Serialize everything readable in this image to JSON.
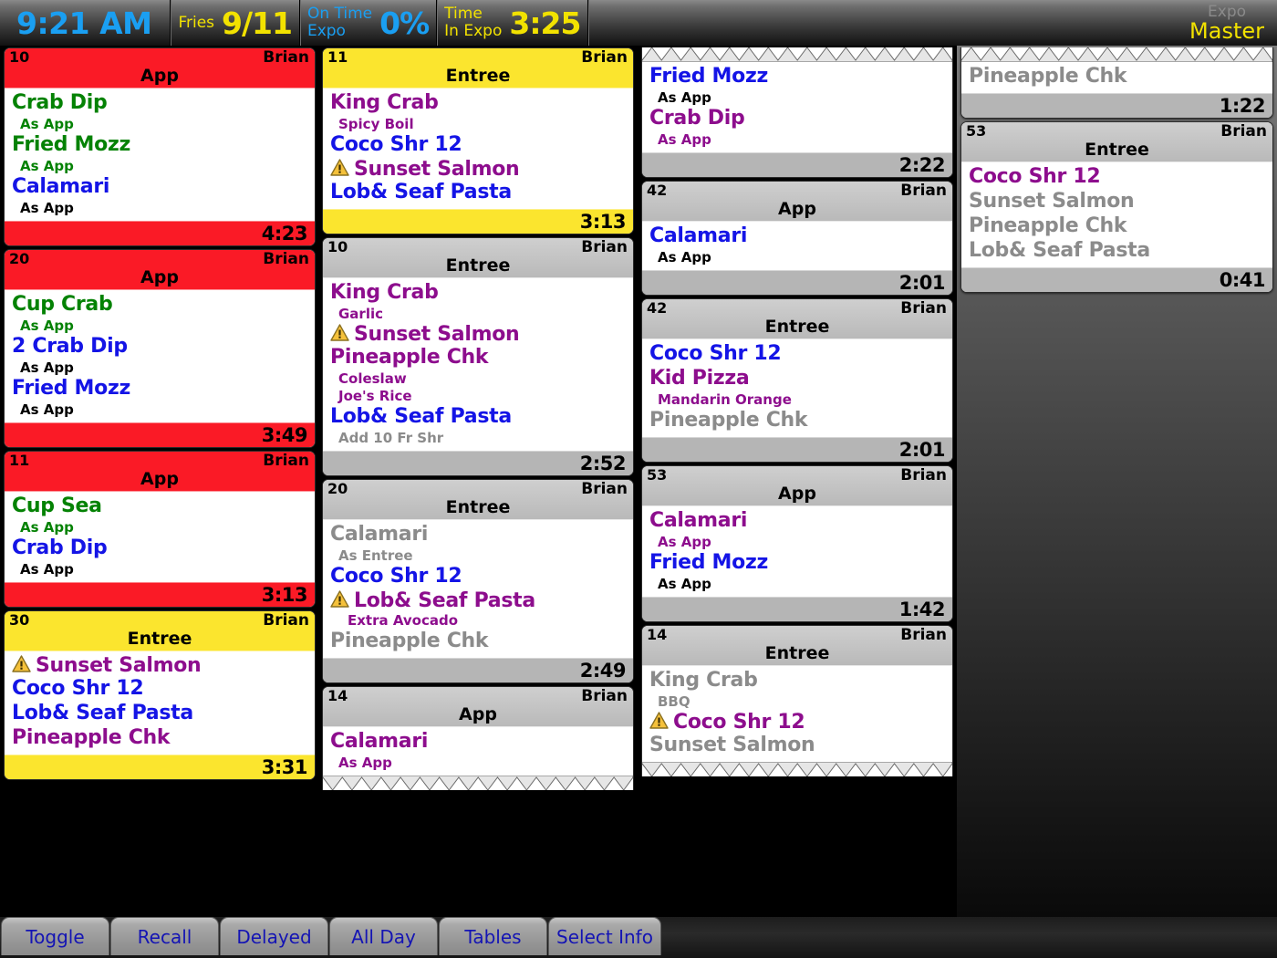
{
  "header": {
    "clock": "9:21 AM",
    "fries_label": "Fries",
    "fries_value": "9/11",
    "ontime_label_1": "On Time",
    "ontime_label_2": "Expo",
    "ontime_value": "0%",
    "timein_label_1": "Time",
    "timein_label_2": "In Expo",
    "timein_value": "3:25",
    "station_label": "Expo",
    "station_name": "Master"
  },
  "colors": {
    "urgent": "#fa1a26",
    "warning": "#fbe52e",
    "normal": "#b9b9b9",
    "accent_blue": "#1a9ff2",
    "accent_yellow": "#f2e200",
    "item_green": "#048204",
    "item_blue": "#1414e6",
    "item_purple": "#8d0d8d",
    "item_done": "#8b8b8b"
  },
  "toolbar": {
    "buttons": [
      {
        "label": "Toggle"
      },
      {
        "label": "Recall"
      },
      {
        "label": "Delayed"
      },
      {
        "label": "All Day"
      },
      {
        "label": "Tables"
      },
      {
        "label": "Select Info"
      }
    ]
  },
  "columns": [
    {
      "tickets": [
        {
          "number": "10",
          "server": "Brian",
          "course": "App",
          "time": "4:23",
          "state": "red",
          "cut_top": false,
          "cut_bottom": false,
          "items": [
            {
              "name": "Crab Dip",
              "color": "green",
              "warn": false,
              "mods": [
                {
                  "text": "As App",
                  "color": "green"
                }
              ]
            },
            {
              "name": "Fried Mozz",
              "color": "green",
              "warn": false,
              "mods": [
                {
                  "text": "As App",
                  "color": "green"
                }
              ]
            },
            {
              "name": "Calamari",
              "color": "blue",
              "warn": false,
              "mods": [
                {
                  "text": "As App",
                  "color": "black"
                }
              ]
            }
          ]
        },
        {
          "number": "20",
          "server": "Brian",
          "course": "App",
          "time": "3:49",
          "state": "red",
          "cut_top": false,
          "cut_bottom": false,
          "items": [
            {
              "name": "Cup Crab",
              "color": "green",
              "warn": false,
              "mods": [
                {
                  "text": "As App",
                  "color": "green"
                }
              ]
            },
            {
              "name": "2 Crab Dip",
              "color": "blue",
              "warn": false,
              "mods": [
                {
                  "text": "As App",
                  "color": "black"
                }
              ]
            },
            {
              "name": "Fried Mozz",
              "color": "blue",
              "warn": false,
              "mods": [
                {
                  "text": "As App",
                  "color": "black"
                }
              ]
            }
          ]
        },
        {
          "number": "11",
          "server": "Brian",
          "course": "App",
          "time": "3:13",
          "state": "red",
          "cut_top": false,
          "cut_bottom": false,
          "items": [
            {
              "name": "Cup Sea",
              "color": "green",
              "warn": false,
              "mods": [
                {
                  "text": "As App",
                  "color": "green"
                }
              ]
            },
            {
              "name": "Crab Dip",
              "color": "blue",
              "warn": false,
              "mods": [
                {
                  "text": "As App",
                  "color": "black"
                }
              ]
            }
          ]
        },
        {
          "number": "30",
          "server": "Brian",
          "course": "Entree",
          "time": "3:31",
          "state": "yellow",
          "cut_top": false,
          "cut_bottom": false,
          "items": [
            {
              "name": "Sunset Salmon",
              "color": "purple",
              "warn": true,
              "mods": []
            },
            {
              "name": "Coco Shr 12",
              "color": "blue",
              "warn": false,
              "mods": []
            },
            {
              "name": "Lob& Seaf Pasta",
              "color": "blue",
              "warn": false,
              "mods": []
            },
            {
              "name": "Pineapple Chk",
              "color": "purple",
              "warn": false,
              "mods": []
            }
          ]
        }
      ]
    },
    {
      "tickets": [
        {
          "number": "11",
          "server": "Brian",
          "course": "Entree",
          "time": "3:13",
          "state": "yellow",
          "cut_top": false,
          "cut_bottom": false,
          "items": [
            {
              "name": "King Crab",
              "color": "purple",
              "warn": false,
              "mods": [
                {
                  "text": "Spicy Boil",
                  "color": "purple"
                }
              ]
            },
            {
              "name": "Coco Shr 12",
              "color": "blue",
              "warn": false,
              "mods": []
            },
            {
              "name": "Sunset Salmon",
              "color": "purple",
              "warn": true,
              "mods": []
            },
            {
              "name": "Lob& Seaf Pasta",
              "color": "blue",
              "warn": false,
              "mods": []
            }
          ]
        },
        {
          "number": "10",
          "server": "Brian",
          "course": "Entree",
          "time": "2:52",
          "state": "gray",
          "cut_top": false,
          "cut_bottom": false,
          "items": [
            {
              "name": "King Crab",
              "color": "purple",
              "warn": false,
              "mods": [
                {
                  "text": "Garlic",
                  "color": "purple"
                }
              ]
            },
            {
              "name": "Sunset Salmon",
              "color": "purple",
              "warn": true,
              "mods": []
            },
            {
              "name": "Pineapple Chk",
              "color": "purple",
              "warn": false,
              "mods": [
                {
                  "text": "Coleslaw",
                  "color": "purple"
                },
                {
                  "text": "Joe's Rice",
                  "color": "purple"
                }
              ]
            },
            {
              "name": "Lob& Seaf Pasta",
              "color": "blue",
              "warn": false,
              "mods": [
                {
                  "text": "Add 10 Fr Shr",
                  "color": "gray"
                }
              ]
            }
          ]
        },
        {
          "number": "20",
          "server": "Brian",
          "course": "Entree",
          "time": "2:49",
          "state": "gray",
          "cut_top": false,
          "cut_bottom": false,
          "items": [
            {
              "name": "Calamari",
              "color": "gray",
              "warn": false,
              "mods": [
                {
                  "text": "As Entree",
                  "color": "gray"
                }
              ]
            },
            {
              "name": "Coco Shr 12",
              "color": "blue",
              "warn": false,
              "mods": []
            },
            {
              "name": "Lob& Seaf Pasta",
              "color": "purple",
              "warn": true,
              "mods": [
                {
                  "text": "Extra Avocado",
                  "color": "purple",
                  "indent2": true
                }
              ]
            },
            {
              "name": "Pineapple Chk",
              "color": "gray",
              "warn": false,
              "mods": []
            }
          ]
        },
        {
          "number": "14",
          "server": "Brian",
          "course": "App",
          "time": "",
          "state": "gray",
          "cut_top": false,
          "cut_bottom": true,
          "items": [
            {
              "name": "Calamari",
              "color": "purple",
              "warn": false,
              "mods": [
                {
                  "text": "As App",
                  "color": "purple"
                }
              ]
            }
          ]
        }
      ]
    },
    {
      "tickets": [
        {
          "number": "",
          "server": "",
          "course": "",
          "time": "2:22",
          "state": "gray",
          "cut_top": true,
          "cut_bottom": false,
          "items": [
            {
              "name": "Fried Mozz",
              "color": "blue",
              "warn": false,
              "mods": [
                {
                  "text": "As App",
                  "color": "black"
                }
              ]
            },
            {
              "name": "Crab Dip",
              "color": "purple",
              "warn": false,
              "mods": [
                {
                  "text": "As App",
                  "color": "purple"
                }
              ]
            }
          ]
        },
        {
          "number": "42",
          "server": "Brian",
          "course": "App",
          "time": "2:01",
          "state": "gray",
          "cut_top": false,
          "cut_bottom": false,
          "items": [
            {
              "name": "Calamari",
              "color": "blue",
              "warn": false,
              "mods": [
                {
                  "text": "As App",
                  "color": "black"
                }
              ]
            }
          ]
        },
        {
          "number": "42",
          "server": "Brian",
          "course": "Entree",
          "time": "2:01",
          "state": "gray",
          "cut_top": false,
          "cut_bottom": false,
          "items": [
            {
              "name": "Coco Shr 12",
              "color": "blue",
              "warn": false,
              "mods": []
            },
            {
              "name": "Kid Pizza",
              "color": "purple",
              "warn": false,
              "mods": [
                {
                  "text": "Mandarin Orange",
                  "color": "purple"
                }
              ]
            },
            {
              "name": "Pineapple Chk",
              "color": "gray",
              "warn": false,
              "mods": []
            }
          ]
        },
        {
          "number": "53",
          "server": "Brian",
          "course": "App",
          "time": "1:42",
          "state": "gray",
          "cut_top": false,
          "cut_bottom": false,
          "items": [
            {
              "name": "Calamari",
              "color": "purple",
              "warn": false,
              "mods": [
                {
                  "text": "As App",
                  "color": "purple"
                }
              ]
            },
            {
              "name": "Fried Mozz",
              "color": "blue",
              "warn": false,
              "mods": [
                {
                  "text": "As App",
                  "color": "black"
                }
              ]
            }
          ]
        },
        {
          "number": "14",
          "server": "Brian",
          "course": "Entree",
          "time": "",
          "state": "gray",
          "cut_top": false,
          "cut_bottom": true,
          "items": [
            {
              "name": "King Crab",
              "color": "gray",
              "warn": false,
              "mods": [
                {
                  "text": "BBQ",
                  "color": "gray"
                }
              ]
            },
            {
              "name": "Coco Shr 12",
              "color": "purple",
              "warn": true,
              "mods": []
            },
            {
              "name": "Sunset Salmon",
              "color": "gray",
              "warn": false,
              "mods": []
            }
          ]
        }
      ]
    },
    {
      "tickets": [
        {
          "number": "",
          "server": "",
          "course": "",
          "time": "1:22",
          "state": "gray",
          "cut_top": true,
          "cut_bottom": false,
          "items": [
            {
              "name": "Pineapple Chk",
              "color": "gray",
              "warn": false,
              "mods": []
            }
          ]
        },
        {
          "number": "53",
          "server": "Brian",
          "course": "Entree",
          "time": "0:41",
          "state": "gray",
          "cut_top": false,
          "cut_bottom": false,
          "items": [
            {
              "name": "Coco Shr 12",
              "color": "purple",
              "warn": false,
              "mods": []
            },
            {
              "name": "Sunset Salmon",
              "color": "gray",
              "warn": false,
              "mods": []
            },
            {
              "name": "Pineapple Chk",
              "color": "gray",
              "warn": false,
              "mods": []
            },
            {
              "name": "Lob& Seaf Pasta",
              "color": "gray",
              "warn": false,
              "mods": []
            }
          ]
        }
      ]
    }
  ]
}
